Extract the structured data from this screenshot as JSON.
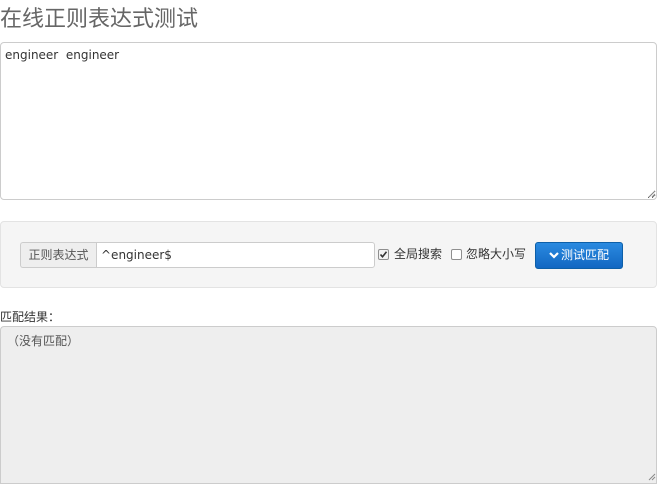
{
  "page": {
    "title": "在线正则表达式测试"
  },
  "source": {
    "text": "engineer  engineer"
  },
  "controls": {
    "regex_label": "正则表达式",
    "regex_value": "^engineer$",
    "global_search": {
      "label": "全局搜索",
      "checked": true
    },
    "ignore_case": {
      "label": "忽略大小写",
      "checked": false
    },
    "test_button_label": "测试匹配",
    "button_color": "#1a73c9"
  },
  "result": {
    "label": "匹配结果：",
    "text": "（没有匹配）"
  }
}
